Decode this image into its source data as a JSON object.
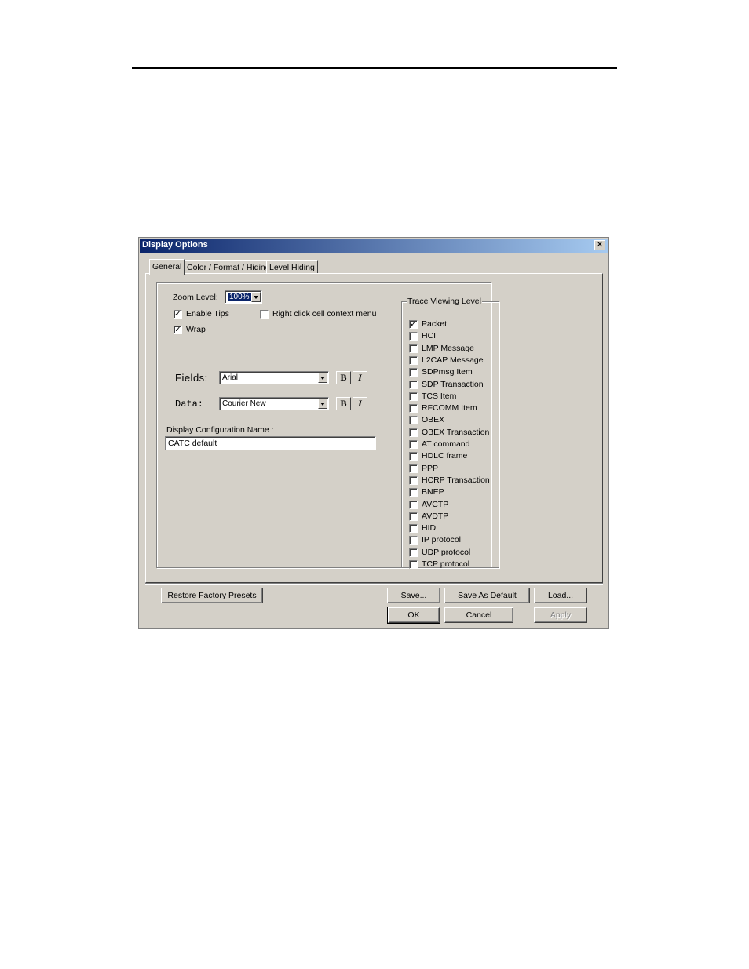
{
  "dialog": {
    "title": "Display Options",
    "close_glyph": "✕",
    "tabs": [
      {
        "label": "General"
      },
      {
        "label": "Color / Format / Hiding"
      },
      {
        "label": "Level Hiding"
      }
    ]
  },
  "general": {
    "zoom_label": "Zoom Level:",
    "zoom_value": "100%",
    "enable_tips_label": "Enable Tips",
    "enable_tips_checked": true,
    "wrap_label": "Wrap",
    "wrap_checked": true,
    "right_click_label": "Right click cell context menu",
    "right_click_checked": false,
    "fields_label": "Fields:",
    "fields_font": "Arial",
    "data_label": "Data:",
    "data_font": "Courier New",
    "bold_label": "B",
    "italic_label": "I",
    "config_name_label": "Display Configuration Name :",
    "config_name_value": "CATC default"
  },
  "trace_viewing_level": {
    "title": "Trace Viewing Level",
    "items": [
      {
        "label": "Packet",
        "checked": true
      },
      {
        "label": "HCI",
        "checked": false
      },
      {
        "label": "LMP Message",
        "checked": false
      },
      {
        "label": "L2CAP Message",
        "checked": false
      },
      {
        "label": "SDPmsg Item",
        "checked": false
      },
      {
        "label": "SDP Transaction",
        "checked": false
      },
      {
        "label": "TCS Item",
        "checked": false
      },
      {
        "label": "RFCOMM Item",
        "checked": false
      },
      {
        "label": "OBEX",
        "checked": false
      },
      {
        "label": "OBEX Transaction",
        "checked": false
      },
      {
        "label": "AT command",
        "checked": false
      },
      {
        "label": "HDLC frame",
        "checked": false
      },
      {
        "label": "PPP",
        "checked": false
      },
      {
        "label": "HCRP Transaction",
        "checked": false
      },
      {
        "label": "BNEP",
        "checked": false
      },
      {
        "label": "AVCTP",
        "checked": false
      },
      {
        "label": "AVDTP",
        "checked": false
      },
      {
        "label": "HID",
        "checked": false
      },
      {
        "label": "IP protocol",
        "checked": false
      },
      {
        "label": "UDP protocol",
        "checked": false
      },
      {
        "label": "TCP protocol",
        "checked": false
      }
    ]
  },
  "buttons": {
    "restore": "Restore Factory Presets",
    "save": "Save...",
    "save_default": "Save As Default",
    "load": "Load...",
    "ok": "OK",
    "cancel": "Cancel",
    "apply": "Apply"
  }
}
